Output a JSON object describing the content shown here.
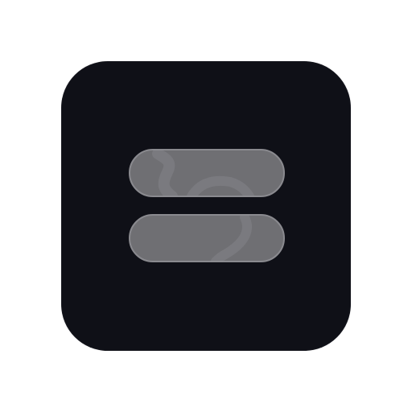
{
  "icon": {
    "name": "double-bar-icon",
    "tile_color": "#0f1017",
    "bar_fill": "#6f6f73",
    "bar_stroke": "#8a8a8f",
    "swirl_color": "#8f8f94"
  }
}
